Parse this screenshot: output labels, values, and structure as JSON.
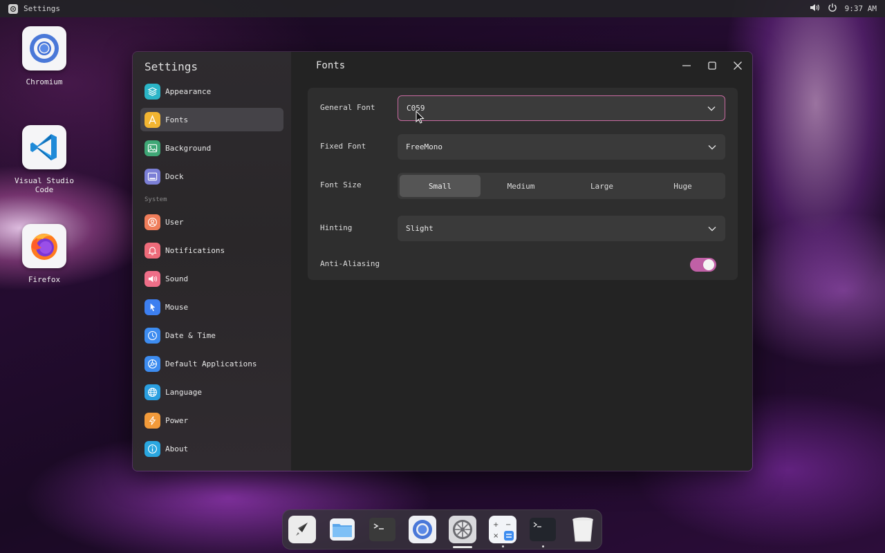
{
  "topbar": {
    "app_name": "Settings",
    "time": "9:37 AM",
    "icons": [
      "settings-app-icon",
      "volume-icon",
      "power-icon"
    ]
  },
  "desktop_icons": [
    {
      "label": "Chromium",
      "icon": "chromium-icon"
    },
    {
      "label": "Visual Studio Code",
      "icon": "vscode-icon"
    },
    {
      "label": "Firefox",
      "icon": "firefox-icon"
    }
  ],
  "window": {
    "sidebar_title": "Settings",
    "page_title": "Fonts",
    "sidebar_items": [
      {
        "label": "Appearance",
        "icon": "layers-icon",
        "color": "#2bb5c7"
      },
      {
        "label": "Fonts",
        "icon": "font-icon",
        "color": "#f2b531",
        "active": true
      },
      {
        "label": "Background",
        "icon": "image-icon",
        "color": "#3fa776"
      },
      {
        "label": "Dock",
        "icon": "dock-icon",
        "color": "#7b7fd6"
      }
    ],
    "system_label": "System",
    "system_items": [
      {
        "label": "User",
        "icon": "user-icon",
        "color": "#ef7d5a"
      },
      {
        "label": "Notifications",
        "icon": "bell-icon",
        "color": "#ee6b7a"
      },
      {
        "label": "Sound",
        "icon": "speaker-icon",
        "color": "#ef6e88"
      },
      {
        "label": "Mouse",
        "icon": "pointer-icon",
        "color": "#3d7ff0"
      },
      {
        "label": "Date & Time",
        "icon": "clock-icon",
        "color": "#3d8cf0"
      },
      {
        "label": "Default Applications",
        "icon": "apps-icon",
        "color": "#3d8cf0"
      },
      {
        "label": "Language",
        "icon": "globe-icon",
        "color": "#2a9fe0"
      },
      {
        "label": "Power",
        "icon": "bolt-icon",
        "color": "#f29a3a"
      },
      {
        "label": "About",
        "icon": "info-icon",
        "color": "#2aa7e0"
      }
    ],
    "fonts": {
      "general_font_label": "General Font",
      "general_font_value": "C059",
      "fixed_font_label": "Fixed Font",
      "fixed_font_value": "FreeMono",
      "font_size_label": "Font Size",
      "font_size_options": [
        "Small",
        "Medium",
        "Large",
        "Huge"
      ],
      "font_size_selected": "Small",
      "hinting_label": "Hinting",
      "hinting_value": "Slight",
      "antialiasing_label": "Anti-Aliasing",
      "antialiasing_on": true
    },
    "accent_color": "#c060a6"
  },
  "dock": {
    "items": [
      "launcher-icon",
      "files-icon",
      "terminal-icon",
      "chromium-icon",
      "settings-icon",
      "calculator-icon",
      "terminal-icon",
      "trash-icon"
    ]
  }
}
